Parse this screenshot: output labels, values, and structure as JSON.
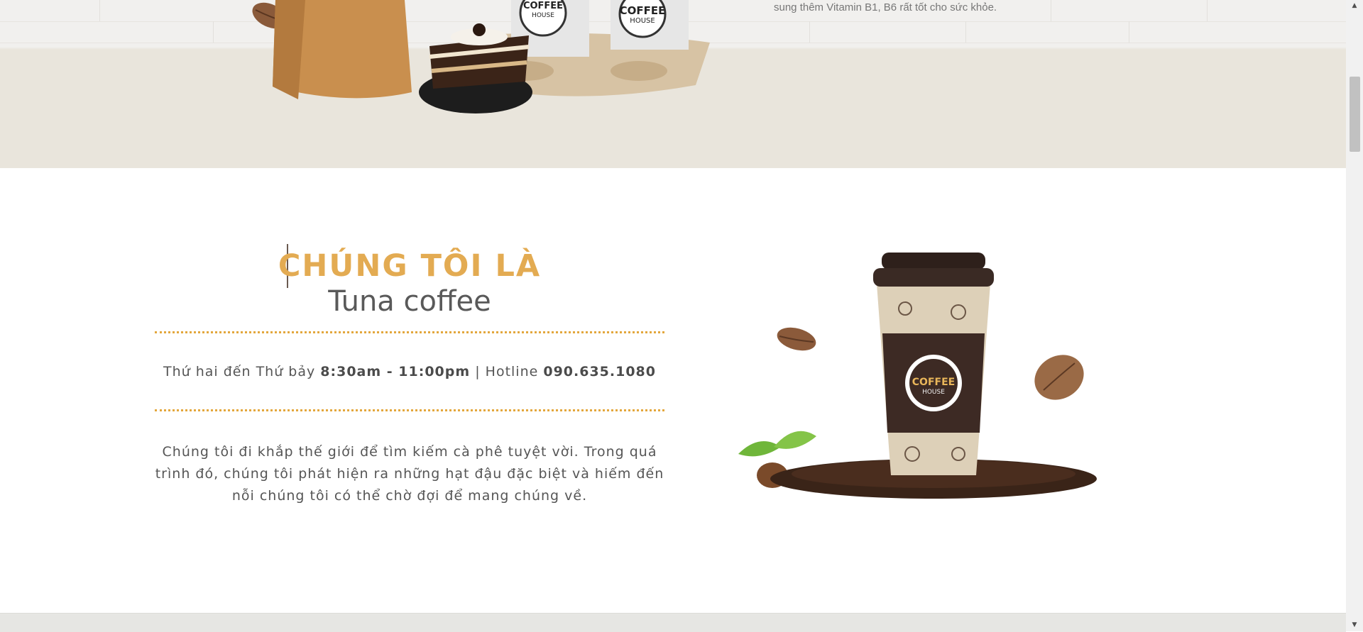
{
  "hero": {
    "text": "sung thêm Vitamin B1, B6 rất tốt cho sức khỏe.",
    "cup_logo_top": "COFFEE",
    "cup_logo_bottom": "HOUSE"
  },
  "about": {
    "title": "CHÚNG TÔI LÀ",
    "subtitle": "Tuna coffee",
    "hours_prefix": "Thứ hai đến Thứ bảy ",
    "hours_time": "8:30am - 11:00pm",
    "hours_sep": " | Hotline ",
    "hotline": "090.635.1080",
    "description": "Chúng tôi đi khắp thế giới để tìm kiếm cà phê tuyệt vời. Trong quá trình đó, chúng tôi phát hiện ra những hạt đậu đặc biệt và hiếm đến nỗi chúng tôi có thể chờ đợi để mang chúng về.",
    "cup_logo_top": "COFFEE",
    "cup_logo_bottom": "HOUSE"
  },
  "colors": {
    "accent": "#e3ab52",
    "text": "#555555",
    "cup_band": "#3d2a24"
  },
  "icons": [
    "scroll-up-arrow",
    "scroll-down-arrow"
  ]
}
